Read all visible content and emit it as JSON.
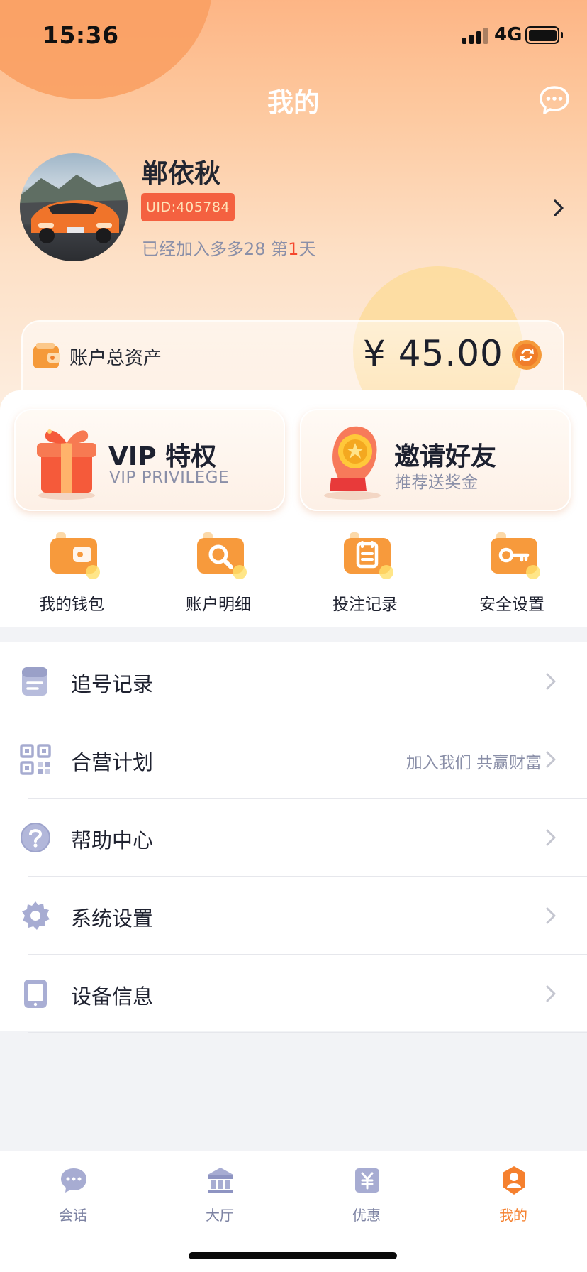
{
  "status_bar": {
    "time": "15:36",
    "network": "4G"
  },
  "header": {
    "title": "我的"
  },
  "profile": {
    "name": "郸依秋",
    "uid": "UID:405784",
    "join_prefix": "已经加入多多28 第",
    "join_days": "1",
    "join_suffix": "天"
  },
  "assets": {
    "label": "账户总资产",
    "value": "¥ 45.00"
  },
  "promos": [
    {
      "title": "VIP 特权",
      "subtitle": "VIP PRIVILEGE"
    },
    {
      "title": "邀请好友",
      "subtitle": "推荐送奖金"
    }
  ],
  "quick_actions": [
    {
      "label": "我的钱包",
      "icon": "wallet-icon"
    },
    {
      "label": "账户明细",
      "icon": "search-icon"
    },
    {
      "label": "投注记录",
      "icon": "record-icon"
    },
    {
      "label": "安全设置",
      "icon": "key-icon"
    }
  ],
  "menu": [
    {
      "label": "追号记录",
      "hint": "",
      "icon": "clipboard-icon"
    },
    {
      "label": "合营计划",
      "hint": "加入我们 共赢财富",
      "icon": "qr-code-icon"
    },
    {
      "label": "帮助中心",
      "hint": "",
      "icon": "help-icon"
    },
    {
      "label": "系统设置",
      "hint": "",
      "icon": "gear-icon"
    },
    {
      "label": "设备信息",
      "hint": "",
      "icon": "device-icon"
    }
  ],
  "tabs": [
    {
      "label": "会话",
      "icon": "chat-icon",
      "active": false
    },
    {
      "label": "大厅",
      "icon": "hall-icon",
      "active": false
    },
    {
      "label": "优惠",
      "icon": "coupon-icon",
      "active": false
    },
    {
      "label": "我的",
      "icon": "profile-icon",
      "active": true
    }
  ],
  "colors": {
    "accent": "#f5802e",
    "uid_badge": "#f46140",
    "muted_text": "#8a8fa8",
    "tab_inactive": "#7d83a3"
  }
}
